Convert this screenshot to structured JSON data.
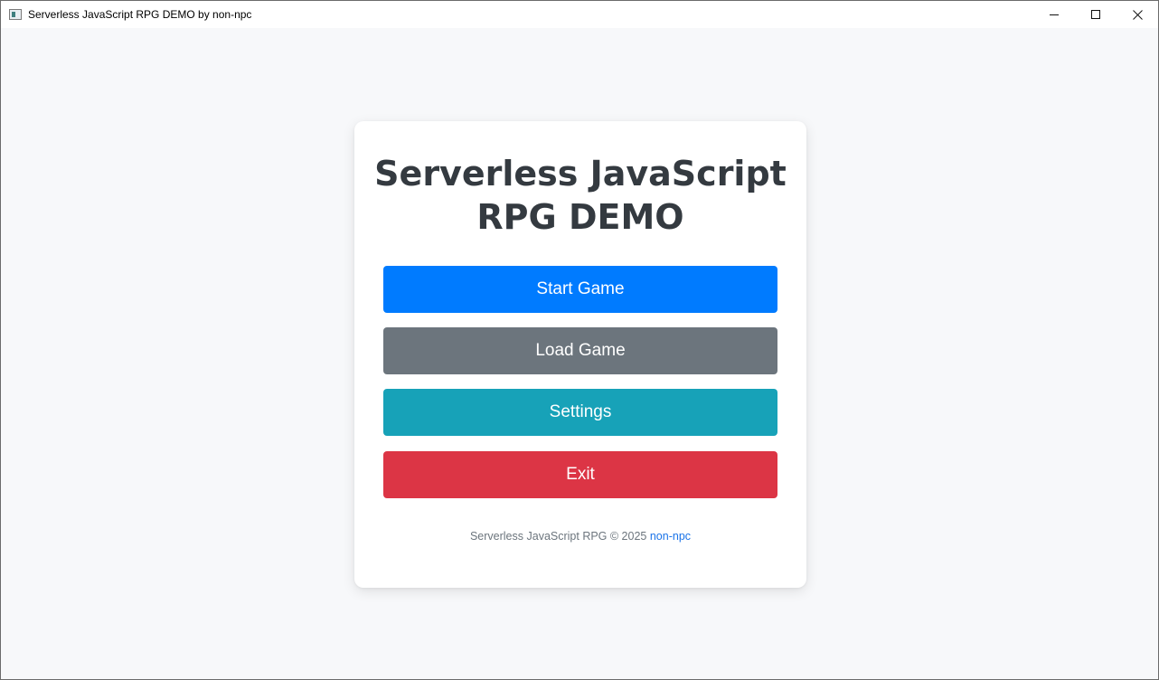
{
  "window": {
    "title": "Serverless JavaScript RPG DEMO by non-npc",
    "controls": [
      "minimize-icon",
      "maximize-icon",
      "close-icon"
    ]
  },
  "menu": {
    "heading": "Serverless JavaScript RPG DEMO",
    "buttons": {
      "start": "Start Game",
      "load": "Load Game",
      "settings": "Settings",
      "exit": "Exit"
    }
  },
  "footer": {
    "text": "Serverless JavaScript RPG © 2025",
    "link": "non-npc"
  },
  "colors": {
    "background": "#f7f8fa",
    "heading": "#343a40",
    "start": "#007bff",
    "load": "#6c757d",
    "settings": "#17a2b8",
    "exit": "#dc3545",
    "footer_text": "#6c757d",
    "footer_link": "#1a73e8"
  }
}
